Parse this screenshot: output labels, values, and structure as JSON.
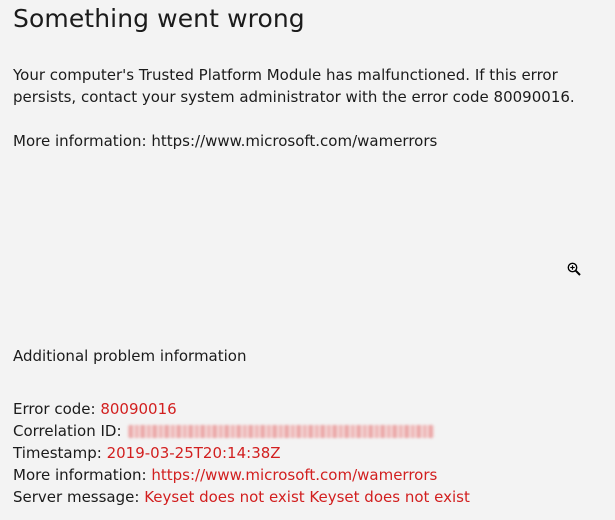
{
  "dialog": {
    "title": "Something went wrong",
    "message": "Your computer's Trusted Platform Module has malfunctioned. If this error persists, contact your system administrator with the error code 80090016.",
    "more_info_label": "More information:",
    "more_info_url": "https://www.microsoft.com/wamerrors"
  },
  "cursor": {
    "icon": "zoom-in-icon"
  },
  "additional": {
    "heading": "Additional problem information",
    "details": {
      "error_code_label": "Error code:",
      "error_code_value": "80090016",
      "correlation_label": "Correlation ID:",
      "timestamp_label": "Timestamp:",
      "timestamp_value": "2019-03-25T20:14:38Z",
      "more_info_label": "More information:",
      "more_info_value": "https://www.microsoft.com/wamerrors",
      "server_message_label": "Server message:",
      "server_message_value": "Keyset does not exist Keyset does not exist"
    }
  },
  "colors": {
    "background": "#f3f3f3",
    "text": "#1b1b1b",
    "error_value": "#d21f1f"
  }
}
